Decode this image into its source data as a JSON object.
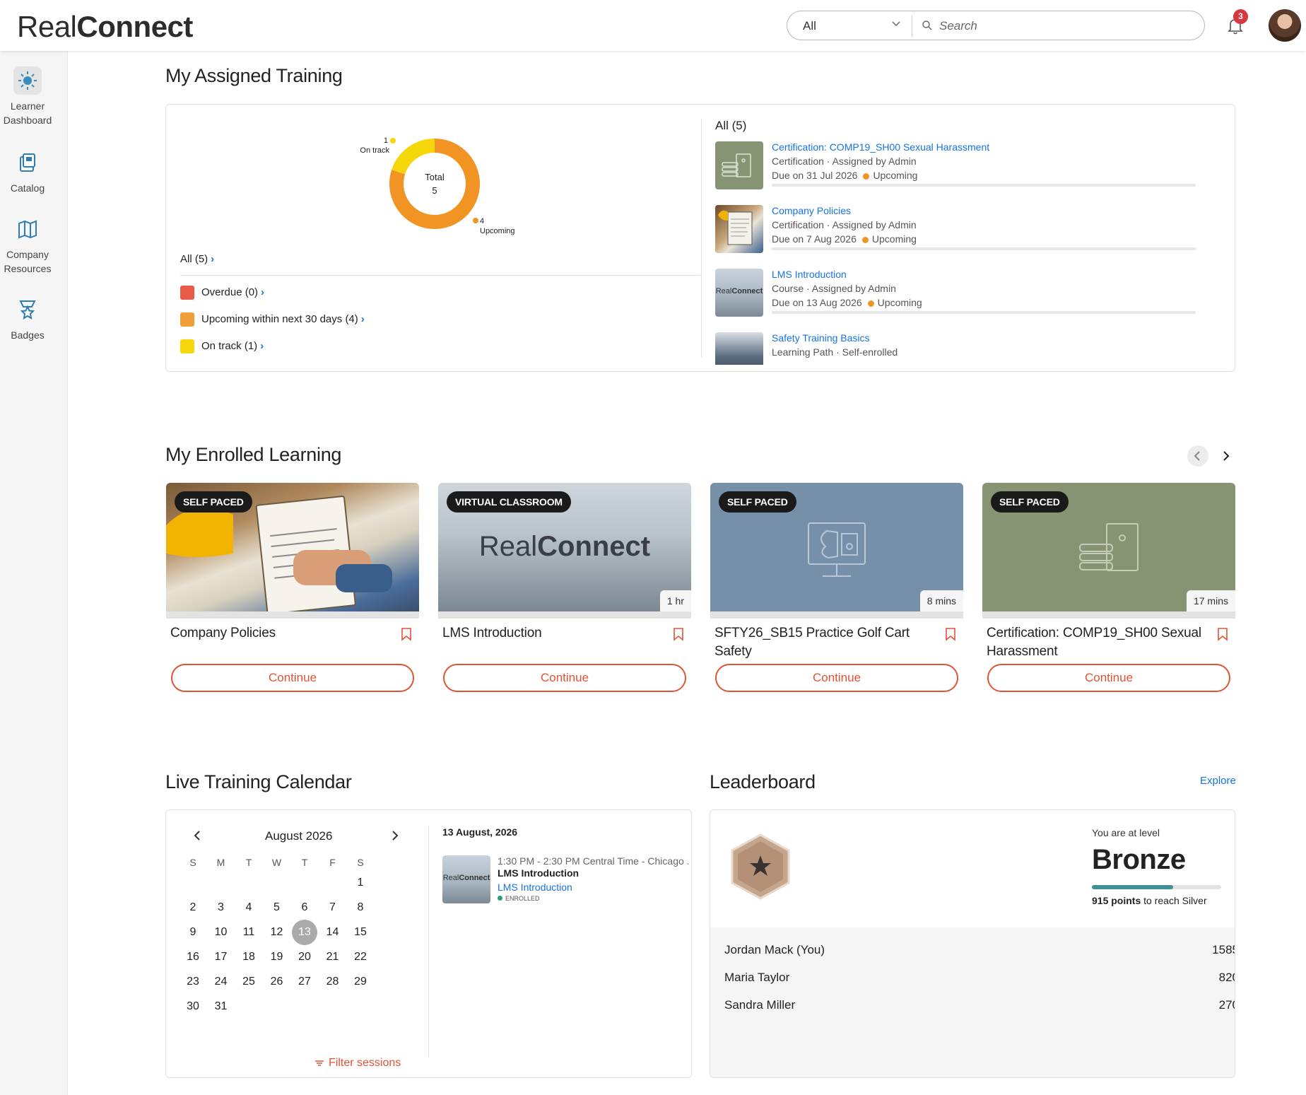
{
  "header": {
    "logo_regular": "Real",
    "logo_bold": "Connect",
    "search_scope": "All",
    "search_placeholder": "Search",
    "notification_count": "3"
  },
  "sidebar": {
    "items": [
      {
        "label_line1": "Learner",
        "label_line2": "Dashboard",
        "icon": "sun-icon",
        "active": true
      },
      {
        "label_line1": "Catalog",
        "label_line2": "",
        "icon": "catalog-icon",
        "active": false
      },
      {
        "label_line1": "Company",
        "label_line2": "Resources",
        "icon": "map-icon",
        "active": false
      },
      {
        "label_line1": "Badges",
        "label_line2": "",
        "icon": "badge-icon",
        "active": false
      }
    ]
  },
  "assigned": {
    "title": "My Assigned Training",
    "donut": {
      "center_label": "Total",
      "center_value": "5",
      "on_track_count": "1",
      "on_track_label": "On track",
      "upcoming_count": "4",
      "upcoming_label": "Upcoming"
    },
    "chart_data": {
      "type": "pie",
      "categories": [
        "Upcoming",
        "On track"
      ],
      "values": [
        4,
        1
      ],
      "colors": [
        "#f29423",
        "#f5d60a"
      ],
      "title": "",
      "center_text": "Total 5"
    },
    "legend_all": "All (5)",
    "legend": [
      {
        "label": "Overdue (0)",
        "color": "#ea5a48"
      },
      {
        "label": "Upcoming within next 30 days (4)",
        "color": "#f29e38"
      },
      {
        "label": "On track (1)",
        "color": "#f5d60a"
      }
    ],
    "list_head": "All (5)",
    "items": [
      {
        "title": "Certification: COMP19_SH00 Sexual Harassment",
        "meta": "Certification · Assigned by Admin",
        "due": "Due on 31 Jul 2026",
        "status": "Upcoming",
        "thumb": "server-thumb"
      },
      {
        "title": "Company Policies",
        "meta": "Certification · Assigned by Admin",
        "due": "Due on 7 Aug 2026",
        "status": "Upcoming",
        "thumb": "clipboard-thumb"
      },
      {
        "title": "LMS Introduction",
        "meta": "Course · Assigned by Admin",
        "due": "Due on 13 Aug 2026",
        "status": "Upcoming",
        "thumb": "lobby-thumb"
      },
      {
        "title": "Safety Training Basics",
        "meta": "Learning Path · Self-enrolled",
        "due": "",
        "status": "",
        "thumb": "building-thumb"
      }
    ]
  },
  "enrolled": {
    "title": "My Enrolled Learning",
    "cards": [
      {
        "badge": "SELF PACED",
        "duration": "",
        "title": "Company Policies",
        "button": "Continue",
        "bg": "photo"
      },
      {
        "badge": "VIRTUAL CLASSROOM",
        "duration": "1 hr",
        "title": "LMS Introduction",
        "button": "Continue",
        "bg": "lobby",
        "overlay_logo_regular": "Real",
        "overlay_logo_bold": "Connect"
      },
      {
        "badge": "SELF PACED",
        "duration": "8 mins",
        "title": "SFTY26_SB15 Practice Golf Cart Safety",
        "button": "Continue",
        "bg": "#7590a8"
      },
      {
        "badge": "SELF PACED",
        "duration": "17 mins",
        "title": "Certification: COMP19_SH00 Sexual Harassment",
        "button": "Continue",
        "bg": "#879473"
      }
    ]
  },
  "calendar": {
    "title": "Live Training Calendar",
    "month": "August 2026",
    "weekdays": [
      "S",
      "M",
      "T",
      "W",
      "T",
      "F",
      "S"
    ],
    "first_weekday_index": 6,
    "days_in_month": 31,
    "selected_day": "13",
    "filter_label": "Filter sessions",
    "session_date": "13 August, 2026",
    "session": {
      "time": "1:30 PM - 2:30 PM Central Time - Chicago ...",
      "name": "LMS Introduction",
      "link": "LMS Introduction",
      "status": "ENROLLED"
    }
  },
  "leaderboard": {
    "title": "Leaderboard",
    "explore": "Explore",
    "level_caption": "You are at level",
    "level": "Bronze",
    "progress_fraction": 0.63,
    "points_to_next_bold": "915 points",
    "points_to_next_rest": " to reach Silver",
    "rows": [
      {
        "name": "Jordan Mack (You)",
        "points": "1585"
      },
      {
        "name": "Maria Taylor",
        "points": "820"
      },
      {
        "name": "Sandra Miller",
        "points": "270"
      }
    ]
  }
}
